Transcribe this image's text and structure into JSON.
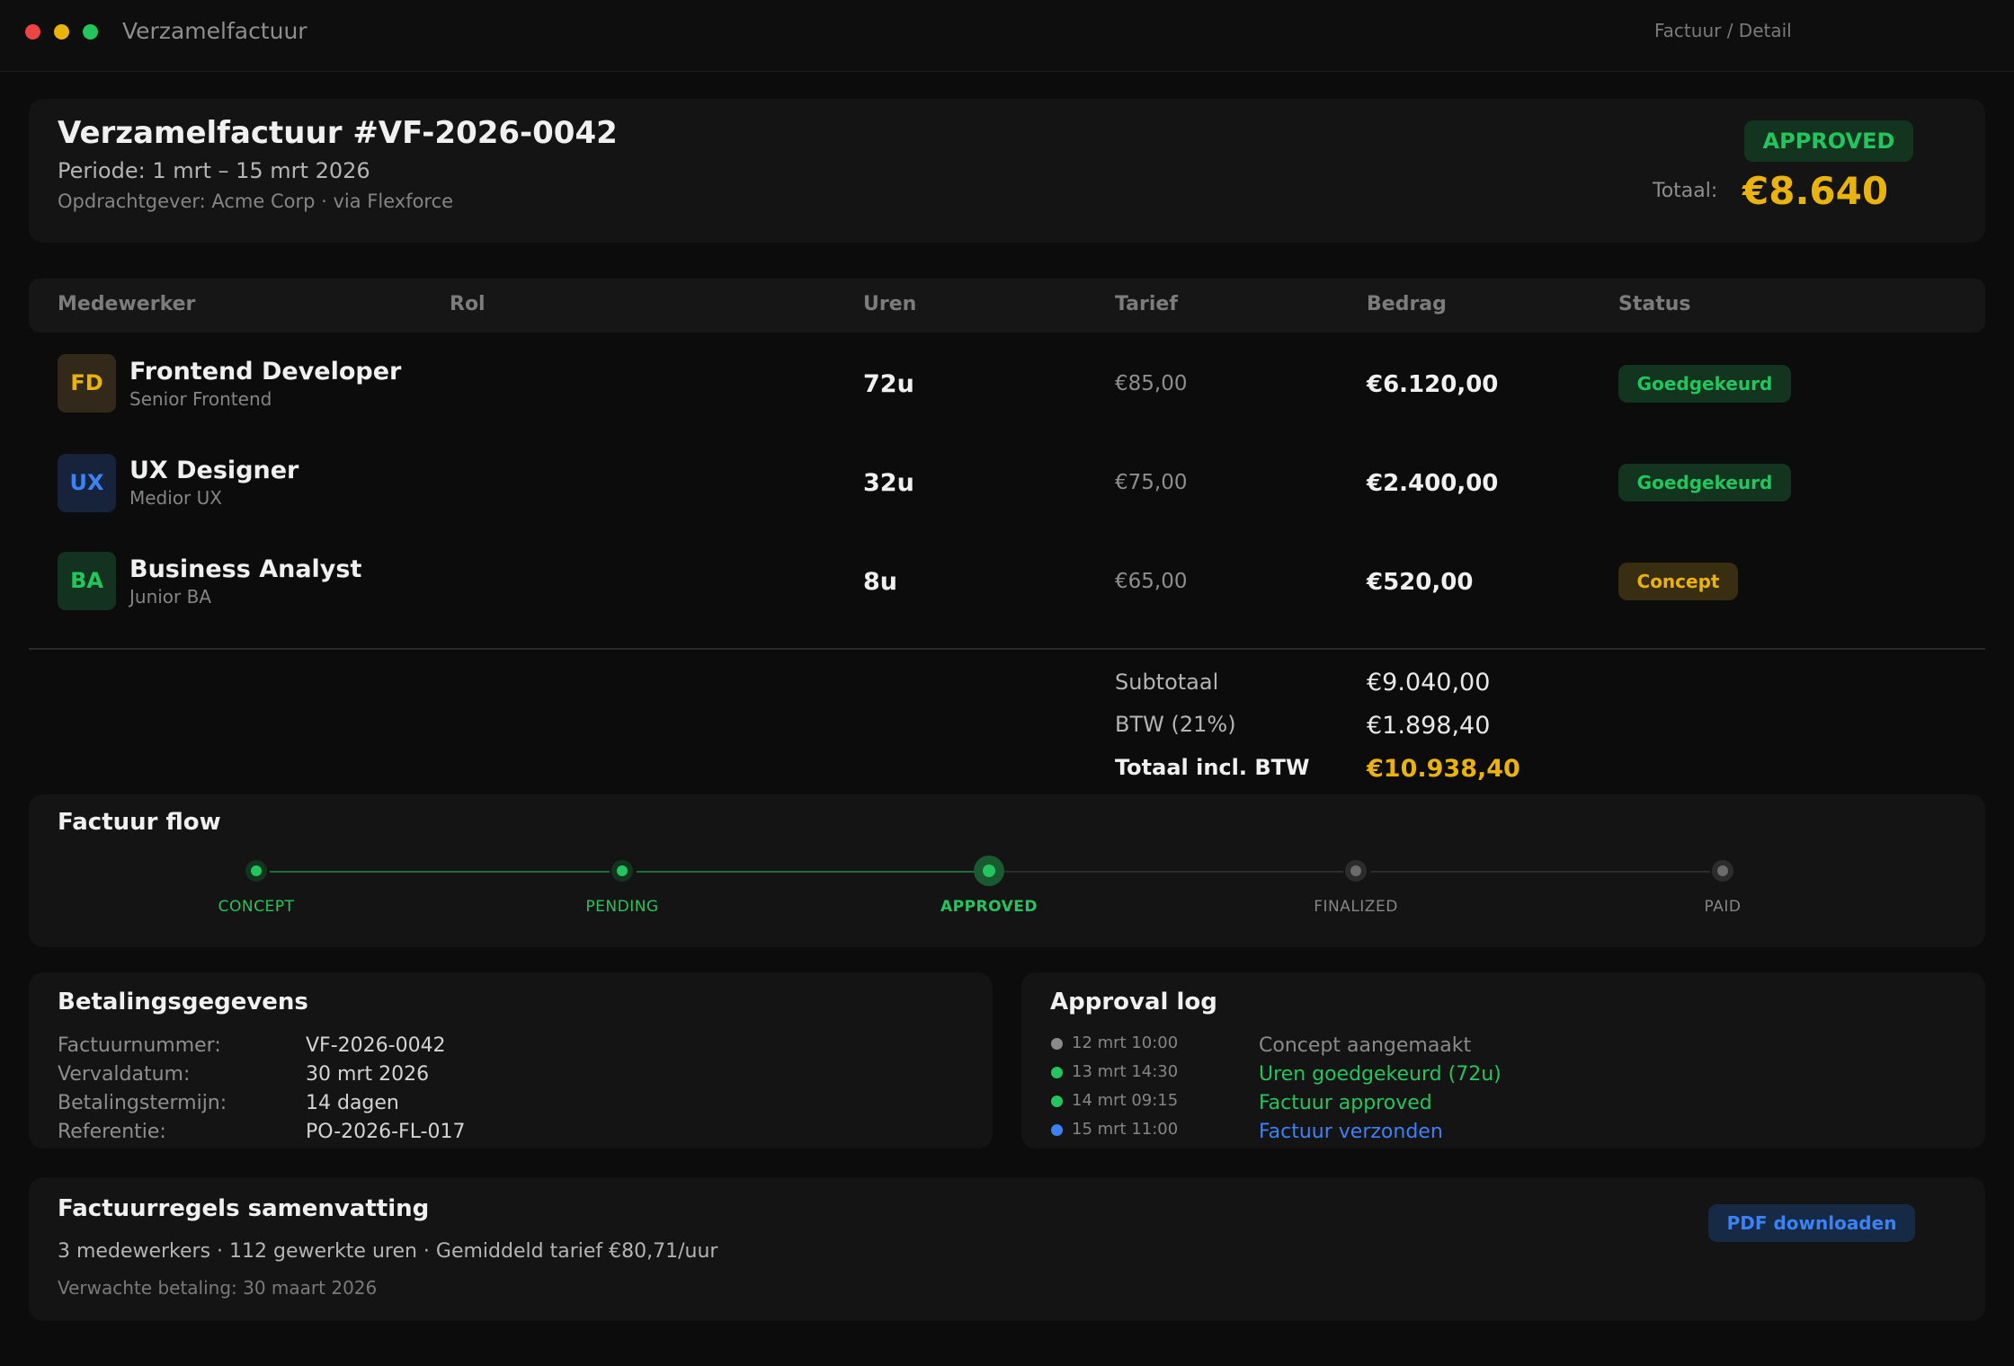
{
  "window": {
    "title": "Verzamelfactuur",
    "breadcrumb": "Factuur / Detail",
    "controls": {
      "close": "#ef4444",
      "minimize": "#eab308",
      "maximize": "#22c55e"
    }
  },
  "header": {
    "title": "Verzamelfactuur #VF-2026-0042",
    "period": "Periode: 1 mrt – 15 mrt 2026",
    "client": "Opdrachtgever: Acme Corp · via Flexforce",
    "status": "APPROVED",
    "total_label": "Totaal:",
    "total_value": "€8.640"
  },
  "table": {
    "columns": [
      "Medewerker",
      "Rol",
      "Uren",
      "Tarief",
      "Bedrag",
      "Status"
    ],
    "rows": [
      {
        "initials": "FD",
        "name": "Frontend Developer",
        "role": "Senior Frontend",
        "hours": "72u",
        "rate": "€85,00",
        "amount": "€6.120,00",
        "status": "Goedgekeurd"
      },
      {
        "initials": "UX",
        "name": "UX Designer",
        "role": "Medior UX",
        "hours": "32u",
        "rate": "€75,00",
        "amount": "€2.400,00",
        "status": "Goedgekeurd"
      },
      {
        "initials": "BA",
        "name": "Business Analyst",
        "role": "Junior BA",
        "hours": "8u",
        "rate": "€65,00",
        "amount": "€520,00",
        "status": "Concept"
      }
    ]
  },
  "totals": {
    "subtotal_label": "Subtotaal",
    "subtotal_value": "€9.040,00",
    "vat_label": "BTW (21%)",
    "vat_value": "€1.898,40",
    "grand_label": "Totaal incl. BTW",
    "grand_value": "€10.938,40"
  },
  "flow": {
    "title": "Factuur flow",
    "steps": [
      "CONCEPT",
      "PENDING",
      "APPROVED",
      "FINALIZED",
      "PAID"
    ],
    "current": "APPROVED"
  },
  "payment": {
    "title": "Betalingsgegevens",
    "rows": [
      {
        "label": "Factuurnummer:",
        "value": "VF-2026-0042"
      },
      {
        "label": "Vervaldatum:",
        "value": "30 mrt 2026"
      },
      {
        "label": "Betalingstermijn:",
        "value": "14 dagen"
      },
      {
        "label": "Referentie:",
        "value": "PO-2026-FL-017"
      }
    ]
  },
  "approval_log": {
    "title": "Approval log",
    "entries": [
      {
        "time": "12 mrt 10:00",
        "text": "Concept aangemaakt",
        "color": "#8a8a8a"
      },
      {
        "time": "13 mrt 14:30",
        "text": "Uren goedgekeurd (72u)",
        "color": "#22c55e"
      },
      {
        "time": "14 mrt 09:15",
        "text": "Factuur approved",
        "color": "#22c55e"
      },
      {
        "time": "15 mrt 11:00",
        "text": "Factuur verzonden",
        "color": "#3b82f6"
      }
    ]
  },
  "summary": {
    "title": "Factuurregels samenvatting",
    "line": "3 medewerkers · 112 gewerkte uren · Gemiddeld tarief €80,71/uur",
    "expected": "Verwachte betaling: 30 maart 2026",
    "pdf_button": "PDF downloaden"
  }
}
